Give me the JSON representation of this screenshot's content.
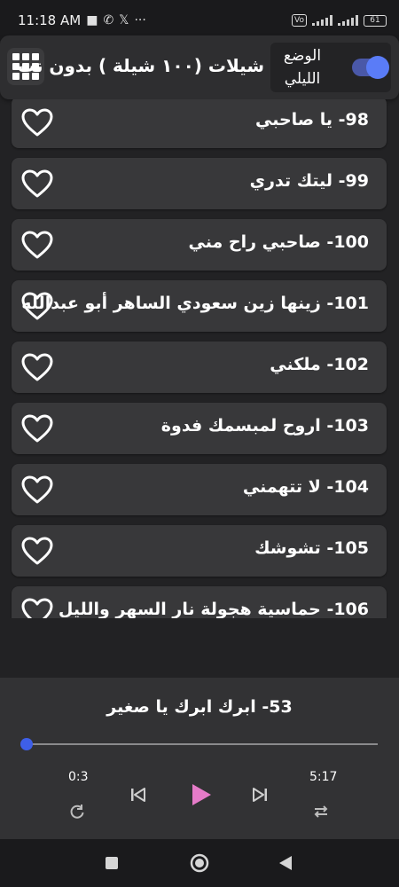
{
  "status_bar": {
    "time": "11:18 AM",
    "battery": "61",
    "icons": [
      "stop-square-icon",
      "wifi-call-icon",
      "x-app-icon",
      "more-dots-icon",
      "volte-icon",
      "signal-icon",
      "battery-icon"
    ]
  },
  "header": {
    "title": "شيلات (١٠٠ شيلة ) بدون نت",
    "night_mode_label": "الوضع الليلي",
    "night_mode_on": true,
    "menu_icon": "grid-icon",
    "accent": "#5a7cf7"
  },
  "list": {
    "items": [
      {
        "label": "98- يا صاحبي",
        "favorite": false
      },
      {
        "label": "99- ليتك تدري",
        "favorite": false
      },
      {
        "label": "100- صاحبي راح مني",
        "favorite": false
      },
      {
        "label": "101- زينها زين سعودي الساهر أبو عبدالله",
        "favorite": false
      },
      {
        "label": "102- ملكني",
        "favorite": false
      },
      {
        "label": "103- اروح لمبسمك فدوة",
        "favorite": false
      },
      {
        "label": "104- لا تتهمني",
        "favorite": false
      },
      {
        "label": "105- تشوشك",
        "favorite": false
      },
      {
        "label": "106- حماسية هجولة نار السهر والليل",
        "favorite": false
      }
    ]
  },
  "player": {
    "now_playing": "53- ابرك ابرك يا صغير",
    "current_time": "0:3",
    "total_time": "5:17",
    "progress": 0.01,
    "play_color": "#e57bc8",
    "controls": [
      "previous-icon",
      "play-icon",
      "next-icon",
      "repeat-icon",
      "shuffle-icon"
    ]
  },
  "nav_bar": {
    "buttons": [
      "recents-square-icon",
      "home-circle-icon",
      "back-triangle-icon"
    ]
  }
}
